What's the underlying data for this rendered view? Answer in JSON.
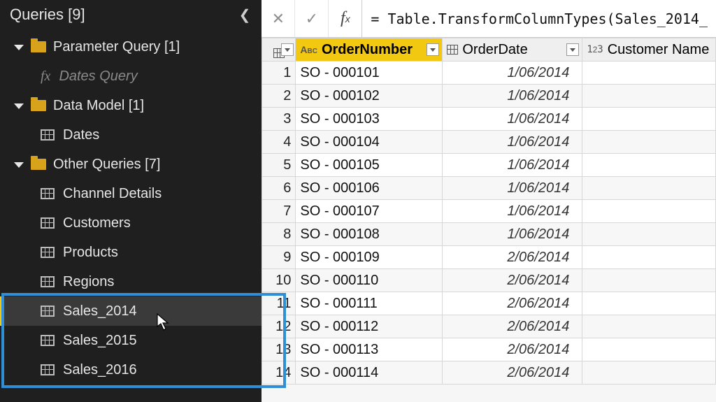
{
  "sidebar": {
    "title": "Queries [9]",
    "groups": [
      {
        "label": "Parameter Query [1]",
        "items": [
          {
            "type": "fx",
            "label": "Dates Query"
          }
        ]
      },
      {
        "label": "Data Model [1]",
        "items": [
          {
            "type": "table",
            "label": "Dates"
          }
        ]
      },
      {
        "label": "Other Queries [7]",
        "items": [
          {
            "type": "table",
            "label": "Channel Details"
          },
          {
            "type": "table",
            "label": "Customers"
          },
          {
            "type": "table",
            "label": "Products"
          },
          {
            "type": "table",
            "label": "Regions"
          },
          {
            "type": "table",
            "label": "Sales_2014",
            "selected": true
          },
          {
            "type": "table",
            "label": "Sales_2015"
          },
          {
            "type": "table",
            "label": "Sales_2016"
          }
        ]
      }
    ]
  },
  "formula": "= Table.TransformColumnTypes(Sales_2014_",
  "columns": {
    "order": "OrderNumber",
    "date": "OrderDate",
    "cust": "Customer Name"
  },
  "rows": [
    {
      "n": "1",
      "order": "SO - 000101",
      "date": "1/06/2014"
    },
    {
      "n": "2",
      "order": "SO - 000102",
      "date": "1/06/2014"
    },
    {
      "n": "3",
      "order": "SO - 000103",
      "date": "1/06/2014"
    },
    {
      "n": "4",
      "order": "SO - 000104",
      "date": "1/06/2014"
    },
    {
      "n": "5",
      "order": "SO - 000105",
      "date": "1/06/2014"
    },
    {
      "n": "6",
      "order": "SO - 000106",
      "date": "1/06/2014"
    },
    {
      "n": "7",
      "order": "SO - 000107",
      "date": "1/06/2014"
    },
    {
      "n": "8",
      "order": "SO - 000108",
      "date": "1/06/2014"
    },
    {
      "n": "9",
      "order": "SO - 000109",
      "date": "2/06/2014"
    },
    {
      "n": "10",
      "order": "SO - 000110",
      "date": "2/06/2014"
    },
    {
      "n": "11",
      "order": "SO - 000111",
      "date": "2/06/2014"
    },
    {
      "n": "12",
      "order": "SO - 000112",
      "date": "2/06/2014"
    },
    {
      "n": "13",
      "order": "SO - 000113",
      "date": "2/06/2014"
    },
    {
      "n": "14",
      "order": "SO - 000114",
      "date": "2/06/2014"
    }
  ]
}
